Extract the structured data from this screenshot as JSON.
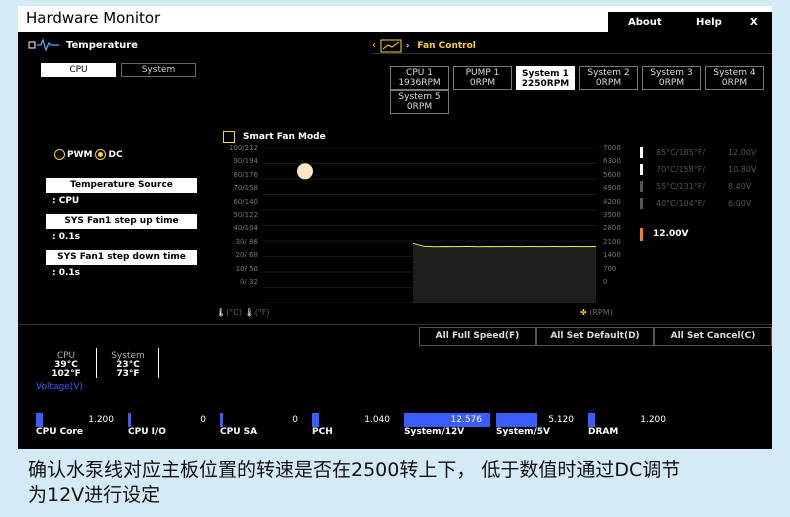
{
  "window": {
    "title": "Hardware Monitor",
    "about": "About",
    "help": "Help",
    "close": "X"
  },
  "temperature_section": {
    "label": "Temperature",
    "tabs": [
      "CPU",
      "System"
    ]
  },
  "fan_control": {
    "label": "Fan Control",
    "fans": [
      {
        "name": "CPU 1",
        "rpm": "1936RPM"
      },
      {
        "name": "PUMP 1",
        "rpm": "0RPM"
      },
      {
        "name": "System 1",
        "rpm": "2250RPM",
        "active": true
      },
      {
        "name": "System 2",
        "rpm": "0RPM"
      },
      {
        "name": "System 3",
        "rpm": "0RPM"
      },
      {
        "name": "System 4",
        "rpm": "0RPM"
      },
      {
        "name": "System 5",
        "rpm": "0RPM"
      }
    ]
  },
  "mode": {
    "pwm": "PWM",
    "dc": "DC",
    "selected": "DC",
    "smart_fan": "Smart Fan Mode"
  },
  "left_panel": {
    "temp_source_label": "Temperature Source",
    "temp_source_value": ": CPU",
    "step_up_label": "SYS Fan1 step up time",
    "step_up_value": ": 0.1s",
    "step_down_label": "SYS Fan1 step down time",
    "step_down_value": ": 0.1s"
  },
  "chart_data": {
    "type": "line",
    "left_ticks": [
      "100/212",
      "90/194",
      "80/176",
      "70/158",
      "60/140",
      "50/122",
      "40/104",
      "30/ 86",
      "20/ 68",
      "10/ 50",
      "0/ 32"
    ],
    "right_ticks": [
      "7000",
      "6300",
      "5600",
      "4900",
      "4200",
      "3500",
      "2800",
      "2100",
      "1400",
      "700",
      "0"
    ],
    "left_units": [
      "(°C)",
      "(°F)"
    ],
    "right_unit": "(RPM)",
    "point_levels": [
      {
        "temp": "85°C/185°F/",
        "volt": "12.00V"
      },
      {
        "temp": "70°C/158°F/",
        "volt": "10.80V"
      },
      {
        "temp": "55°C/131°F/",
        "volt": "8.40V"
      },
      {
        "temp": "40°C/104°F/",
        "volt": "6.00V"
      }
    ],
    "current_voltage": "12.00V",
    "curve_point_level": 0.85,
    "rpm_ymax": 7000,
    "rpm_series": [
      2700,
      2560,
      2540,
      2550,
      2545,
      2555,
      2540,
      2550,
      2545,
      2550,
      2548,
      2552,
      2545,
      2550,
      2547,
      2551,
      2546,
      2550
    ],
    "accent_color": "#ff7a2a",
    "line_color": "#c8ff3c"
  },
  "actions": {
    "full_speed": "All Full Speed(F)",
    "set_default": "All Set Default(D)",
    "set_cancel": "All Set Cancel(C)"
  },
  "monitor": {
    "cpu": {
      "label": "CPU",
      "c": "39°C",
      "f": "102°F"
    },
    "system": {
      "label": "System",
      "c": "23°C",
      "f": "73°F"
    },
    "voltage_label": "Voltage(V)"
  },
  "voltages": [
    {
      "label": "CPU Core",
      "value": "1.200",
      "fill": 0.08
    },
    {
      "label": "CPU I/O",
      "value": "0",
      "fill": 0.03
    },
    {
      "label": "CPU SA",
      "value": "0",
      "fill": 0.03
    },
    {
      "label": "PCH",
      "value": "1.040",
      "fill": 0.08
    },
    {
      "label": "System/12V",
      "value": "12.576",
      "fill": 0.95
    },
    {
      "label": "System/5V",
      "value": "5.120",
      "fill": 0.45
    },
    {
      "label": "DRAM",
      "value": "1.200",
      "fill": 0.08
    }
  ],
  "caption": {
    "line1": "确认水泵线对应主板位置的转速是否在2500转上下， 低于数值时通过DC调节",
    "line2": "为12V进行设定"
  }
}
